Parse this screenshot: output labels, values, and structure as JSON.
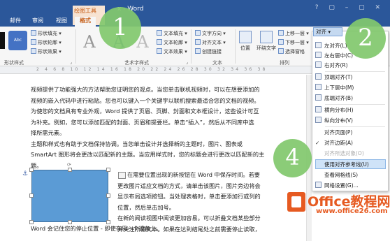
{
  "window": {
    "title": "x - Word"
  },
  "ribbon": {
    "context_label": "绘图工具",
    "tabs": [
      "邮件",
      "审阅",
      "视图",
      "格式"
    ],
    "shape_styles": {
      "sample_label": "Abc",
      "fill": "形状填充",
      "outline": "形状轮廓",
      "effects": "形状效果",
      "group_label": "形状样式"
    },
    "wordart": {
      "text_fill": "文本填充",
      "text_outline": "文本轮廓",
      "text_effects": "文本效果",
      "group_label": "艺术字样式"
    },
    "text_group": {
      "direction": "文字方向",
      "align": "对齐文本",
      "link": "创建链接",
      "group_label": "文本"
    },
    "arrange": {
      "position": "位置",
      "wrap": "环绕文字",
      "bring_forward": "上移一层",
      "send_backward": "下移一层",
      "selection_pane": "选择窗格",
      "align_btn": "对齐",
      "group_label": "排列"
    }
  },
  "ruler": {
    "numbers": "2 4 6 8 10 12 14 16 18 20 22 24 26 28 30 32 34 36 38"
  },
  "document": {
    "para1_lines": [
      "视频提供了功能强大的方法帮助您证明您的观点。当您单击联机视频时，可以在想要添加的",
      "视频的嵌入代码中进行粘贴。您也可以键入一个关键字以联机搜索最适合您的文档的视频。",
      "为使您的文档具有专业外观，Word 提供了页眉、页脚、封面和文本框设计，这些设计可互",
      "为补充。例如，您可以添加匹配的封面、页眉和提要栏。单击“插入”，然后从不同库中选",
      "择所需元素。",
      "主题和样式也有助于文档保持协调。当您单击设计并选择新的主题时，图片、图表或",
      "SmartArt 图形将会更改以匹配新的主题。当应用样式时，您的标题会进行更改以匹配新的主题。"
    ],
    "para2_lines": [
      "在需要位置出现的新按钮在 Word 中保存时间。若要",
      "更改图片适应文档的方式，请单击该图片，图片旁边将会",
      "显示布局选项按钮。当处理表格时，单击要添加行或列的",
      "位置，然后单击加号。",
      "在新的阅读视图中阅读更加容易。可以折叠文档某些部分",
      "并关注所需文本。如果在达到结尾处之前需要停止读取，"
    ],
    "para3_line": "Word 会记住您的停止位置 - 即使在另一个设备上。"
  },
  "dropdown": {
    "header": "对齐",
    "items": [
      {
        "label": "左对齐(L)",
        "type": "icon"
      },
      {
        "label": "左右居中(C)",
        "type": "icon"
      },
      {
        "label": "右对齐(R)",
        "type": "icon"
      },
      {
        "label": "顶端对齐(T)",
        "type": "icon"
      },
      {
        "label": "上下居中(M)",
        "type": "icon"
      },
      {
        "label": "底端对齐(B)",
        "type": "icon"
      },
      {
        "label": "横向分布(H)",
        "type": "icon"
      },
      {
        "label": "纵向分布(V)",
        "type": "icon"
      },
      {
        "label": "对齐页面(P)",
        "type": "plain"
      },
      {
        "label": "对齐边距(A)",
        "type": "check",
        "check": "✓"
      },
      {
        "label": "对齐所选对象(O)",
        "type": "disabled"
      },
      {
        "label": "使用对齐参考线(U)",
        "type": "highlight"
      },
      {
        "label": "查看网格线(S)",
        "type": "plain"
      },
      {
        "label": "网格设置(G)...",
        "type": "icon"
      }
    ]
  },
  "callouts": {
    "one": "1",
    "two": "2",
    "four": "4"
  },
  "watermark": {
    "title": "Office教程网",
    "url": "www.office26.com"
  },
  "colors": {
    "ribbon_blue": "#2b579a",
    "accent_orange": "#e65a21",
    "shape_blue": "#5b9bd5",
    "callout_green": "#82c86e"
  }
}
